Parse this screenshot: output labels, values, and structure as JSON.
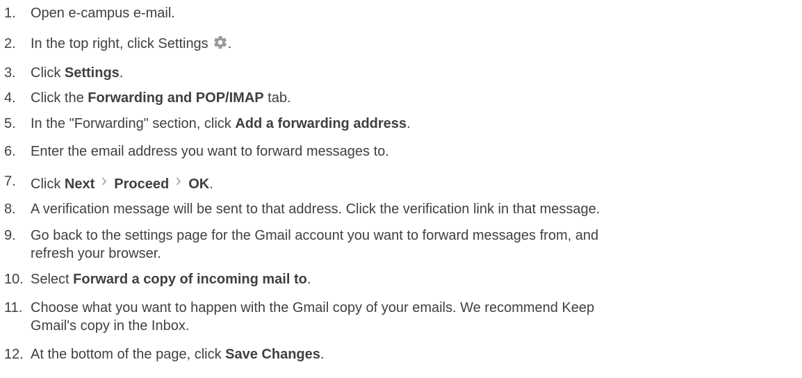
{
  "steps": [
    {
      "num": "1.",
      "text": "Open e-campus e-mail."
    },
    {
      "num": "2.",
      "pre": "In the top right, click Settings",
      "post": ".",
      "icon": "gear-icon",
      "icon_color": "#999999"
    },
    {
      "num": "3.",
      "pre": "Click ",
      "bold": "Settings",
      "post": "."
    },
    {
      "num": "4.",
      "pre": "Click the ",
      "bold": "Forwarding and POP/IMAP",
      "post": " tab."
    },
    {
      "num": "5.",
      "pre": "In the \"Forwarding\" section, click ",
      "bold": "Add a forwarding address",
      "post": "."
    },
    {
      "num": "6.",
      "text": "Enter the email address you want to forward messages to."
    },
    {
      "num": "7.",
      "pre": "Click ",
      "b1": "Next",
      "b2": "Proceed",
      "b3": "OK",
      "post": ".",
      "icon": "chevron-right-icon",
      "icon_color": "#aaaaaa"
    },
    {
      "num": "8.",
      "text": "A verification message will be sent to that address. Click the verification link in that message."
    },
    {
      "num": "9.",
      "line1": "Go back to the settings page for the Gmail account you want to forward messages from, and",
      "line2": "refresh your browser."
    },
    {
      "num": "10.",
      "pre": "Select ",
      "bold": "Forward a copy of incoming mail to",
      "post": "."
    },
    {
      "num": "11.",
      "line1": "Choose what you want to happen with the Gmail copy of your emails. We recommend Keep",
      "line2": "Gmail's copy in the Inbox."
    },
    {
      "num": "12.",
      "pre": "At the bottom of the page, click ",
      "bold": "Save Changes",
      "post": "."
    }
  ]
}
